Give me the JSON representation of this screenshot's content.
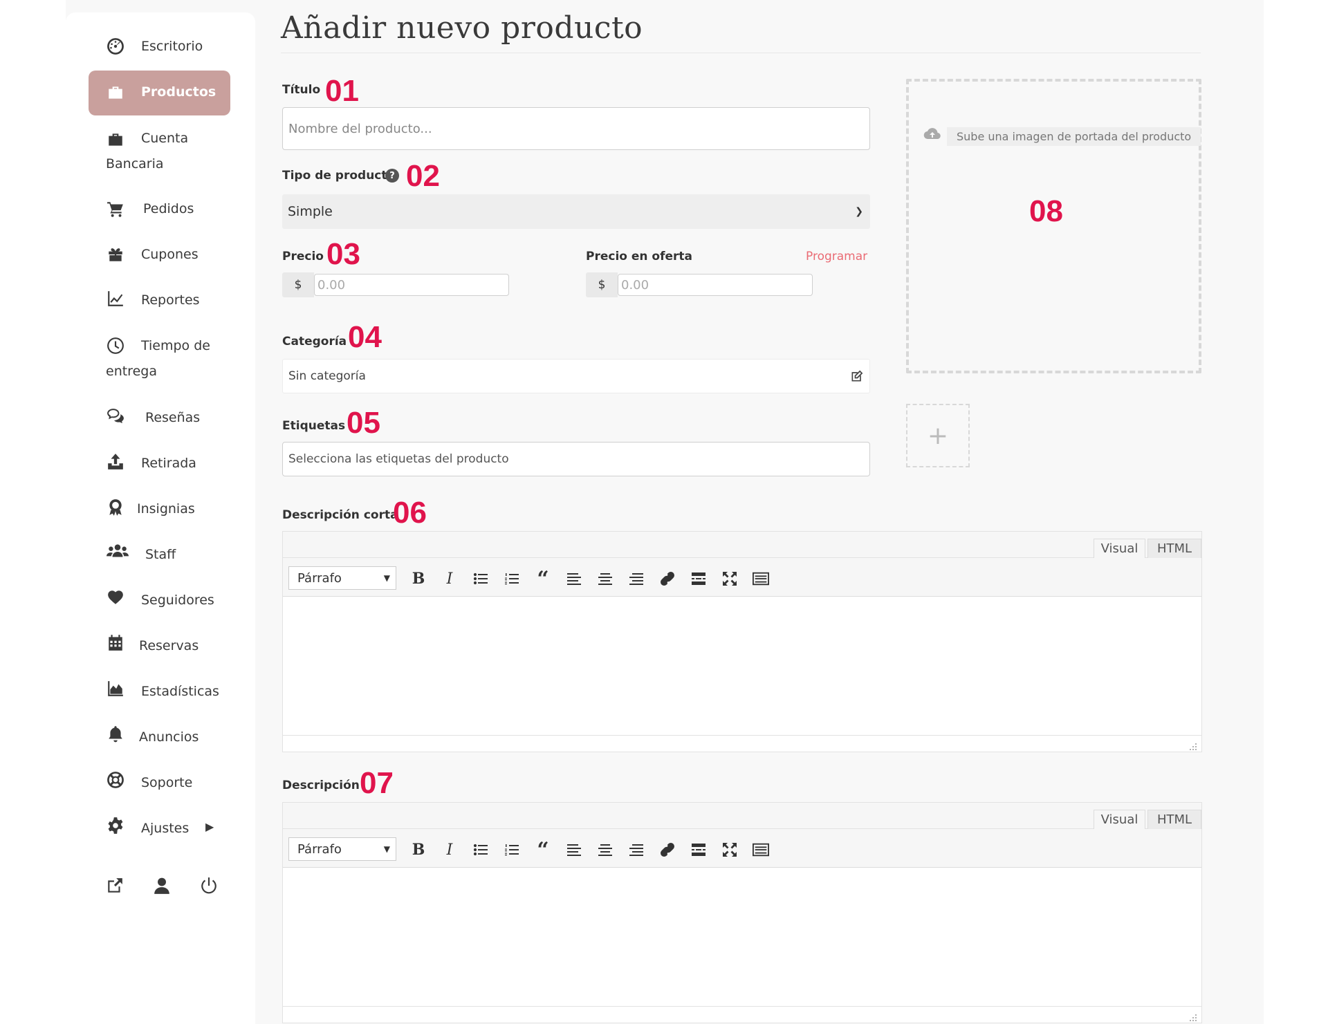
{
  "sidebar": {
    "items": [
      {
        "label": "Escritorio",
        "icon": "dashboard-icon"
      },
      {
        "label": "Productos",
        "icon": "briefcase-icon",
        "active": true
      },
      {
        "label": "Cuenta Bancaria",
        "icon": "briefcase-icon"
      },
      {
        "label": "Pedidos",
        "icon": "cart-icon"
      },
      {
        "label": "Cupones",
        "icon": "gift-icon"
      },
      {
        "label": "Reportes",
        "icon": "line-chart-icon"
      },
      {
        "label": "Tiempo de entrega",
        "icon": "clock-icon"
      },
      {
        "label": "Reseñas",
        "icon": "comments-icon"
      },
      {
        "label": "Retirada",
        "icon": "upload-icon"
      },
      {
        "label": "Insignias",
        "icon": "award-icon"
      },
      {
        "label": "Staff",
        "icon": "users-icon"
      },
      {
        "label": "Seguidores",
        "icon": "heart-icon"
      },
      {
        "label": "Reservas",
        "icon": "calendar-icon"
      },
      {
        "label": "Estadísticas",
        "icon": "area-chart-icon"
      },
      {
        "label": "Anuncios",
        "icon": "bell-icon"
      },
      {
        "label": "Soporte",
        "icon": "lifebuoy-icon"
      },
      {
        "label": "Ajustes",
        "icon": "gear-icon"
      }
    ],
    "footer_icons": [
      "external-link-icon",
      "user-icon",
      "power-icon"
    ],
    "active_color": "#c9a09d"
  },
  "page": {
    "title": "Añadir nuevo producto"
  },
  "form": {
    "title_label": "Título",
    "title_placeholder": "Nombre del producto...",
    "type_label": "Tipo de producto",
    "type_value": "Simple",
    "price_label": "Precio",
    "price_currency": "$",
    "price_placeholder": "0.00",
    "sale_label": "Precio en oferta",
    "sale_currency": "$",
    "sale_placeholder": "0.00",
    "schedule_link": "Programar",
    "category_label": "Categoría",
    "category_value": "Sin categoría",
    "tags_label": "Etiquetas",
    "tags_placeholder": "Selecciona las etiquetas del producto",
    "short_desc_label": "Descripción corta",
    "desc_label": "Descripción",
    "upload_hint": "Sube una imagen de portada del producto",
    "gallery_add": "+"
  },
  "editor": {
    "tab_visual": "Visual",
    "tab_html": "HTML",
    "format_value": "Párrafo",
    "toolbar": [
      "bold-icon",
      "italic-icon",
      "bullet-list-icon",
      "numbered-list-icon",
      "blockquote-icon",
      "align-left-icon",
      "align-center-icon",
      "align-right-icon",
      "link-icon",
      "read-more-icon",
      "fullscreen-icon",
      "keyboard-icon"
    ]
  },
  "steps": [
    "01",
    "02",
    "03",
    "04",
    "05",
    "06",
    "07",
    "08"
  ],
  "colors": {
    "step": "#e0144c",
    "link": "#ea6b74"
  }
}
